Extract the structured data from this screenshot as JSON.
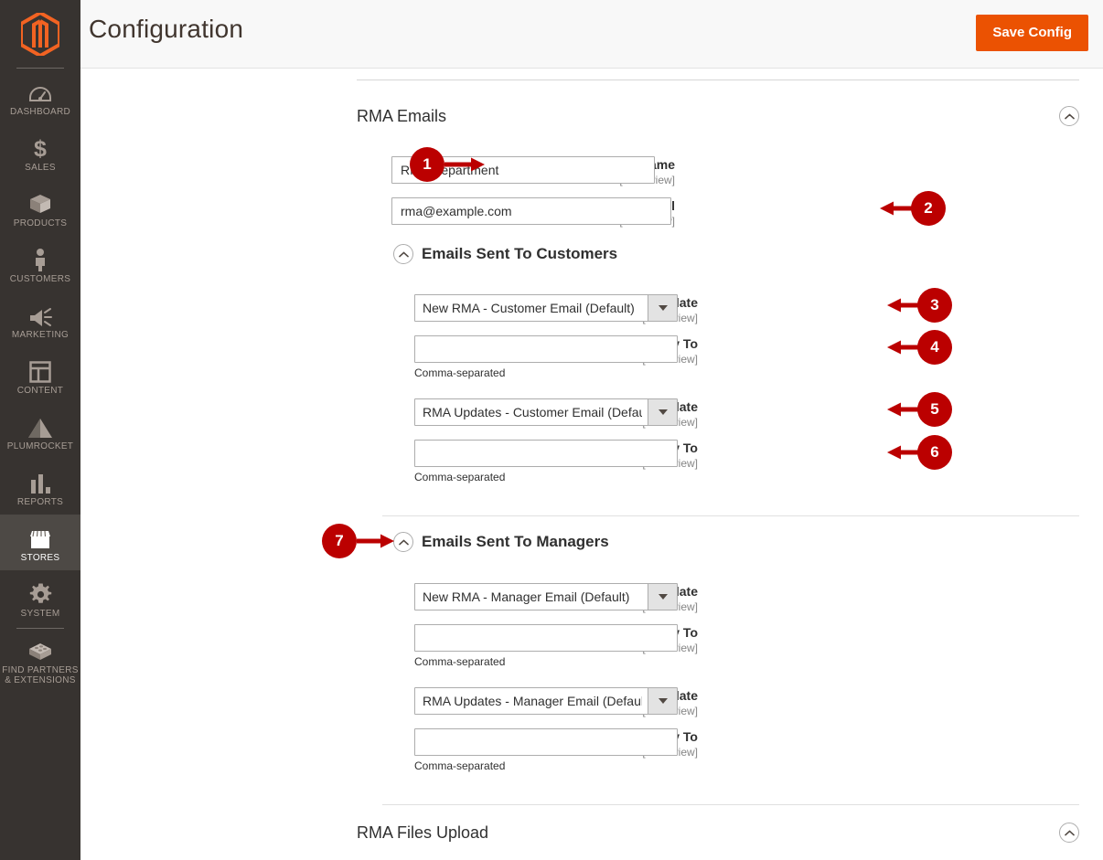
{
  "sidebar": {
    "logo_name": "magento-logo",
    "items": [
      {
        "label": "DASHBOARD",
        "icon": "dashboard-icon",
        "active": false
      },
      {
        "label": "SALES",
        "icon": "dollar-icon",
        "active": false
      },
      {
        "label": "PRODUCTS",
        "icon": "box-icon",
        "active": false
      },
      {
        "label": "CUSTOMERS",
        "icon": "person-icon",
        "active": false
      },
      {
        "label": "MARKETING",
        "icon": "megaphone-icon",
        "active": false
      },
      {
        "label": "CONTENT",
        "icon": "layout-icon",
        "active": false
      },
      {
        "label": "PLUMROCKET",
        "icon": "pyramid-icon",
        "active": false
      },
      {
        "label": "REPORTS",
        "icon": "bar-chart-icon",
        "active": false
      },
      {
        "label": "STORES",
        "icon": "store-icon",
        "active": true
      },
      {
        "label": "SYSTEM",
        "icon": "gear-icon",
        "active": false
      },
      {
        "label": "FIND PARTNERS\n& EXTENSIONS",
        "icon": "extensions-icon",
        "active": false
      }
    ]
  },
  "header": {
    "title": "Configuration",
    "save_label": "Save Config"
  },
  "main": {
    "section_title": "RMA Emails",
    "collapse_icon": "chevron-up-circle-icon",
    "sender_name": {
      "label": "Sender Name",
      "scope": "[store view]",
      "value": "RMA Department"
    },
    "sender_email": {
      "label": "Sender Email",
      "scope": "[store view]",
      "value": "rma@example.com"
    },
    "customers": {
      "title": "Emails Sent To Customers",
      "new_rma_template": {
        "label": "New RMA Confirmation Template",
        "scope": "[store view]",
        "value": "New RMA - Customer Email (Default)"
      },
      "confirmation_copy_to": {
        "label": "Send RMA Confirmation Email Copy To",
        "scope": "[store view]",
        "value": "",
        "hint": "Comma-separated"
      },
      "updates_template": {
        "label": "RMA Updates Template",
        "scope": "[store view]",
        "value": "RMA Updates - Customer Email (Default)"
      },
      "updates_copy_to": {
        "label": "Send RMA Updates Email Copy To",
        "scope": "[store view]",
        "value": "",
        "hint": "Comma-separated"
      }
    },
    "managers": {
      "title": "Emails Sent To Managers",
      "new_rma_template": {
        "label": "New RMA Confirmation Template",
        "scope": "[store view]",
        "value": "New RMA - Manager Email (Default)"
      },
      "confirmation_copy_to": {
        "label": "Send RMA Confirmation Email Copy To",
        "scope": "[store view]",
        "value": "",
        "hint": "Comma-separated"
      },
      "updates_template": {
        "label": "RMA Updates Template",
        "scope": "[store view]",
        "value": "RMA Updates - Manager Email (Default)"
      },
      "updates_copy_to": {
        "label": "Send RMA Updates Email Copy To",
        "scope": "[store view]",
        "value": "",
        "hint": "Comma-separated"
      }
    },
    "files_upload": {
      "title": "RMA Files Upload",
      "collapse_icon": "chevron-up-circle-icon"
    }
  },
  "annotations": {
    "color": "#bb0000",
    "badges": [
      {
        "n": "1",
        "direction": "right"
      },
      {
        "n": "2",
        "direction": "left"
      },
      {
        "n": "3",
        "direction": "left"
      },
      {
        "n": "4",
        "direction": "left"
      },
      {
        "n": "5",
        "direction": "left"
      },
      {
        "n": "6",
        "direction": "left"
      },
      {
        "n": "7",
        "direction": "right"
      }
    ]
  },
  "colors": {
    "brand_orange": "#eb5202",
    "sidebar_bg": "#373330",
    "sidebar_active": "#4d4945",
    "annotation_red": "#bb0000",
    "text_dark": "#303030"
  }
}
